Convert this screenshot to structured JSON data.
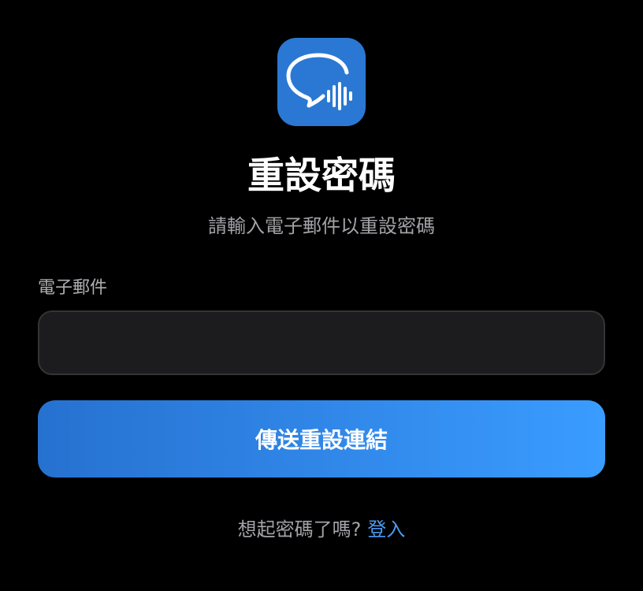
{
  "app_icon": {
    "name": "chat-voice-icon",
    "bg_color": "#2a78d3"
  },
  "title": "重設密碼",
  "subtitle": "請輸入電子郵件以重設密碼",
  "email_field": {
    "label": "電子郵件",
    "value": "",
    "placeholder": ""
  },
  "send_button": {
    "label": "傳送重設連結",
    "gradient": [
      "#2671d0",
      "#3a9cff"
    ]
  },
  "footer": {
    "prompt": "想起密碼了嗎?",
    "login_link": "登入",
    "link_color": "#4b9bf0"
  }
}
